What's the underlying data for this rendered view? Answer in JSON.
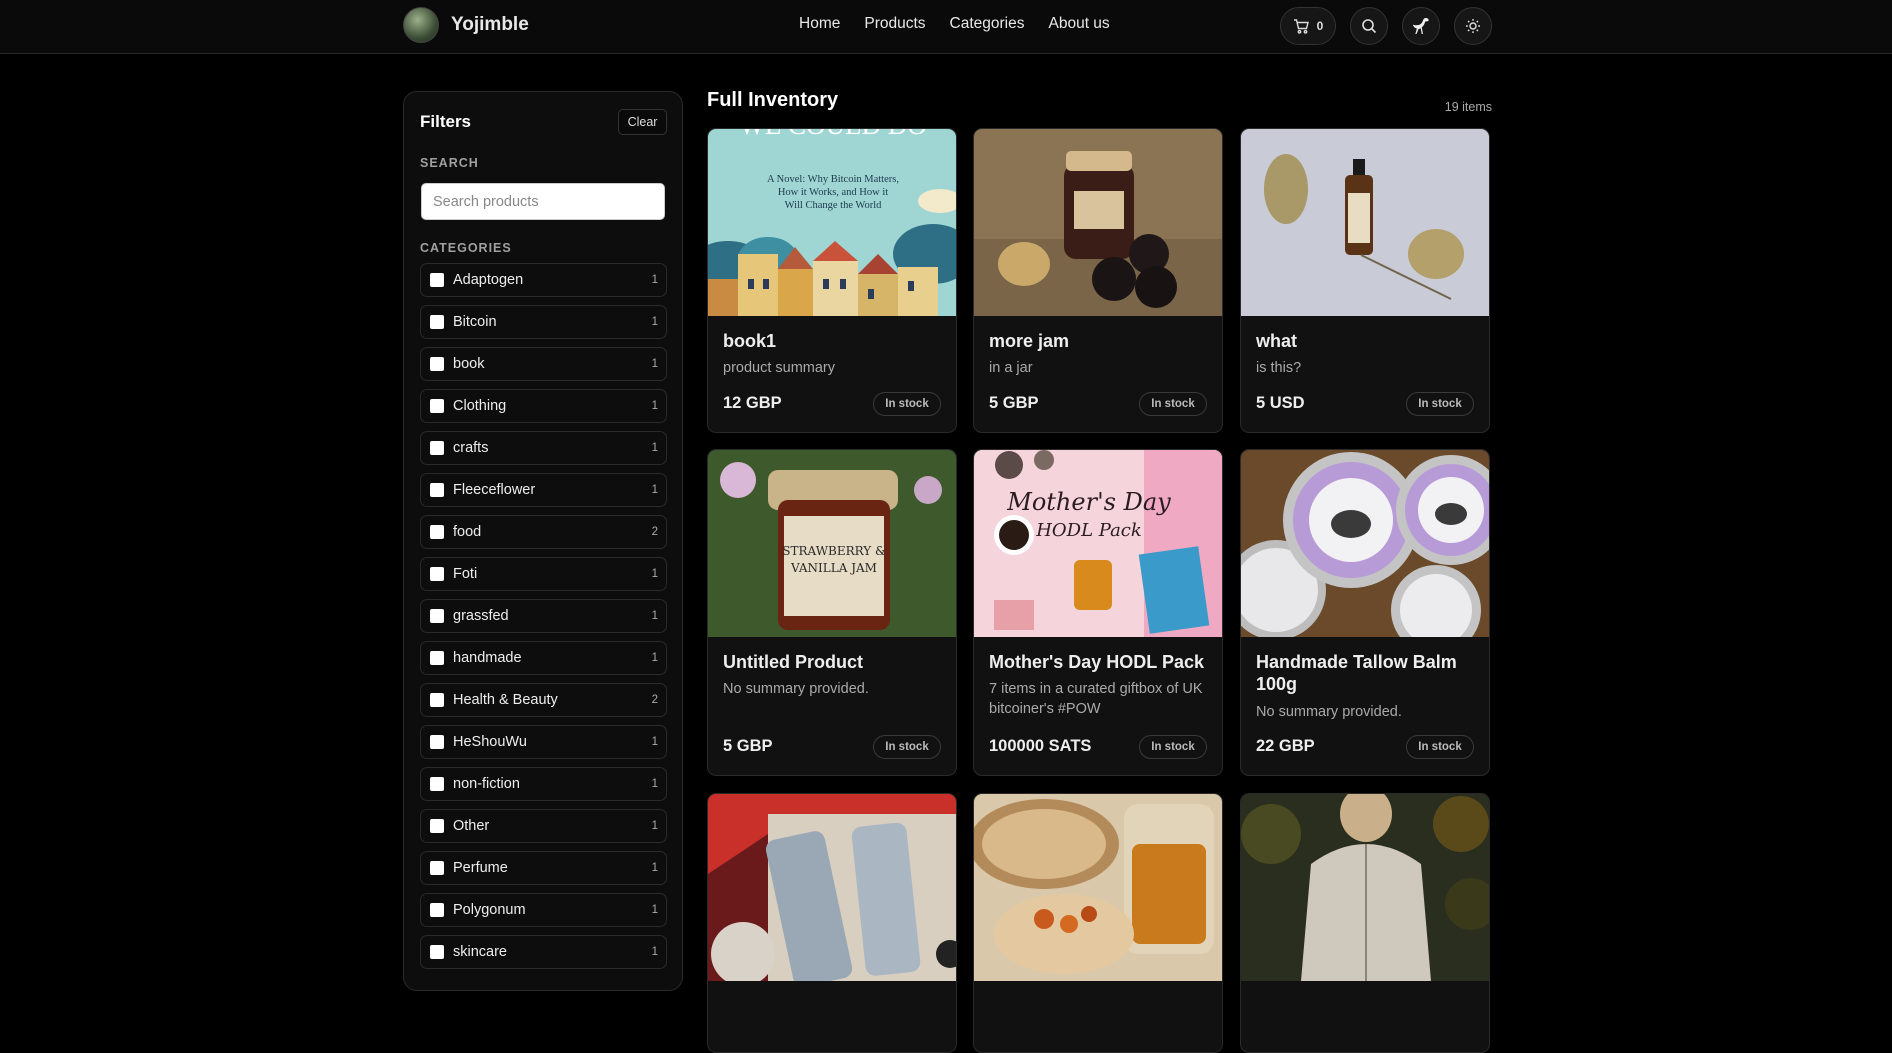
{
  "header": {
    "brand": "Yojimble",
    "nav": [
      "Home",
      "Products",
      "Categories",
      "About us"
    ],
    "cart_count": "0",
    "icons": [
      "cart-icon",
      "search-icon",
      "ostrich-icon",
      "sun-icon"
    ]
  },
  "filters": {
    "title": "Filters",
    "clear_label": "Clear",
    "search_label": "SEARCH",
    "search_placeholder": "Search products",
    "categories_label": "CATEGORIES",
    "categories": [
      {
        "label": "Adaptogen",
        "count": "1"
      },
      {
        "label": "Bitcoin",
        "count": "1"
      },
      {
        "label": "book",
        "count": "1"
      },
      {
        "label": "Clothing",
        "count": "1"
      },
      {
        "label": "crafts",
        "count": "1"
      },
      {
        "label": "Fleeceflower",
        "count": "1"
      },
      {
        "label": "food",
        "count": "2"
      },
      {
        "label": "Foti",
        "count": "1"
      },
      {
        "label": "grassfed",
        "count": "1"
      },
      {
        "label": "handmade",
        "count": "1"
      },
      {
        "label": "Health & Beauty",
        "count": "2"
      },
      {
        "label": "HeShouWu",
        "count": "1"
      },
      {
        "label": "non-fiction",
        "count": "1"
      },
      {
        "label": "Other",
        "count": "1"
      },
      {
        "label": "Perfume",
        "count": "1"
      },
      {
        "label": "Polygonum",
        "count": "1"
      },
      {
        "label": "skincare",
        "count": "1"
      }
    ]
  },
  "main": {
    "title": "Full Inventory",
    "item_count": "19 items",
    "products": [
      {
        "name": "book1",
        "summary": "product summary",
        "price": "12 GBP",
        "stock": "In stock",
        "image_text": [
          "WE COULD DO",
          "A Novel: Why Bitcoin Matters,",
          "How it Works, and How it",
          "Will Change the World"
        ]
      },
      {
        "name": "more jam",
        "summary": "in a jar",
        "price": "5 GBP",
        "stock": "In stock",
        "image_text": []
      },
      {
        "name": "what",
        "summary": "is this?",
        "price": "5 USD",
        "stock": "In stock",
        "image_text": []
      },
      {
        "name": "Untitled Product",
        "summary": "No summary provided.",
        "price": "5 GBP",
        "stock": "In stock",
        "image_text": [
          "STRAWBERRY &",
          "VANILLA JAM"
        ]
      },
      {
        "name": "Mother's Day HODL Pack",
        "summary": "7 items in a curated giftbox of UK bitcoiner's #POW",
        "price": "100000 SATS",
        "stock": "In stock",
        "image_text": [
          "Mother's Day",
          "HODL Pack"
        ]
      },
      {
        "name": "Handmade Tallow Balm 100g",
        "summary": "No summary provided.",
        "price": "22 GBP",
        "stock": "In stock",
        "image_text": []
      },
      {
        "name": "",
        "summary": "",
        "price": "",
        "stock": "",
        "image_text": []
      },
      {
        "name": "",
        "summary": "",
        "price": "",
        "stock": "",
        "image_text": []
      },
      {
        "name": "",
        "summary": "",
        "price": "",
        "stock": "",
        "image_text": []
      }
    ]
  }
}
